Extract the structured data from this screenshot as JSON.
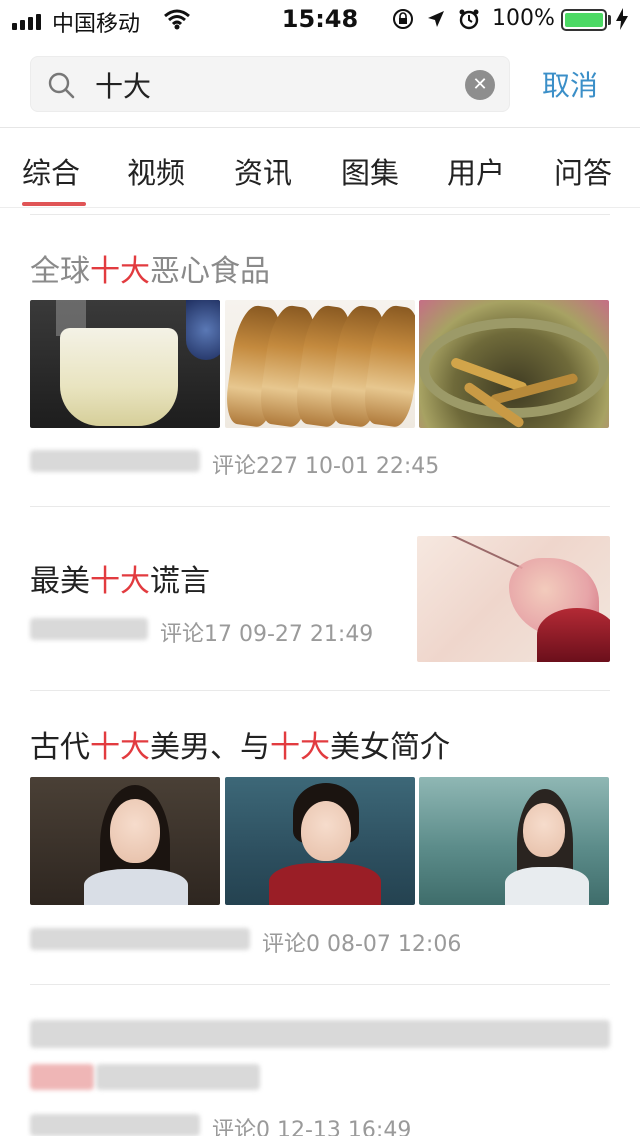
{
  "status_bar": {
    "carrier": "中国移动",
    "time": "15:48",
    "battery": "100%"
  },
  "search": {
    "query": "十大",
    "cancel": "取消"
  },
  "tabs": [
    "综合",
    "视频",
    "资讯",
    "图集",
    "用户",
    "问答"
  ],
  "active_tab": 0,
  "results": [
    {
      "title_parts": [
        "全球",
        "十大",
        "恶心食品"
      ],
      "meta": "评论227  10-01 22:45",
      "thumbnails": [
        "fermented-drink-image",
        "dried-fish-image",
        "eels-in-pot-image"
      ]
    },
    {
      "title_parts": [
        "最美",
        "十大",
        "谎言"
      ],
      "meta": "评论17  09-27 21:49",
      "thumbnails": [
        "ancient-painting-image"
      ]
    },
    {
      "title_parts": [
        "古代",
        "十大",
        "美男、与",
        "十大",
        "美女简介"
      ],
      "meta": "评论0  08-07 12:06",
      "thumbnails": [
        "actress-image-1",
        "actress-image-2",
        "actress-image-3"
      ]
    },
    {
      "title_parts": [],
      "meta": "评论0  12-13 16:49",
      "thumbnails": []
    }
  ],
  "colors": {
    "highlight": "#e23b3f",
    "accent": "#3b8fc8",
    "tab_indicator": "#e05456",
    "battery": "#4cd964"
  }
}
